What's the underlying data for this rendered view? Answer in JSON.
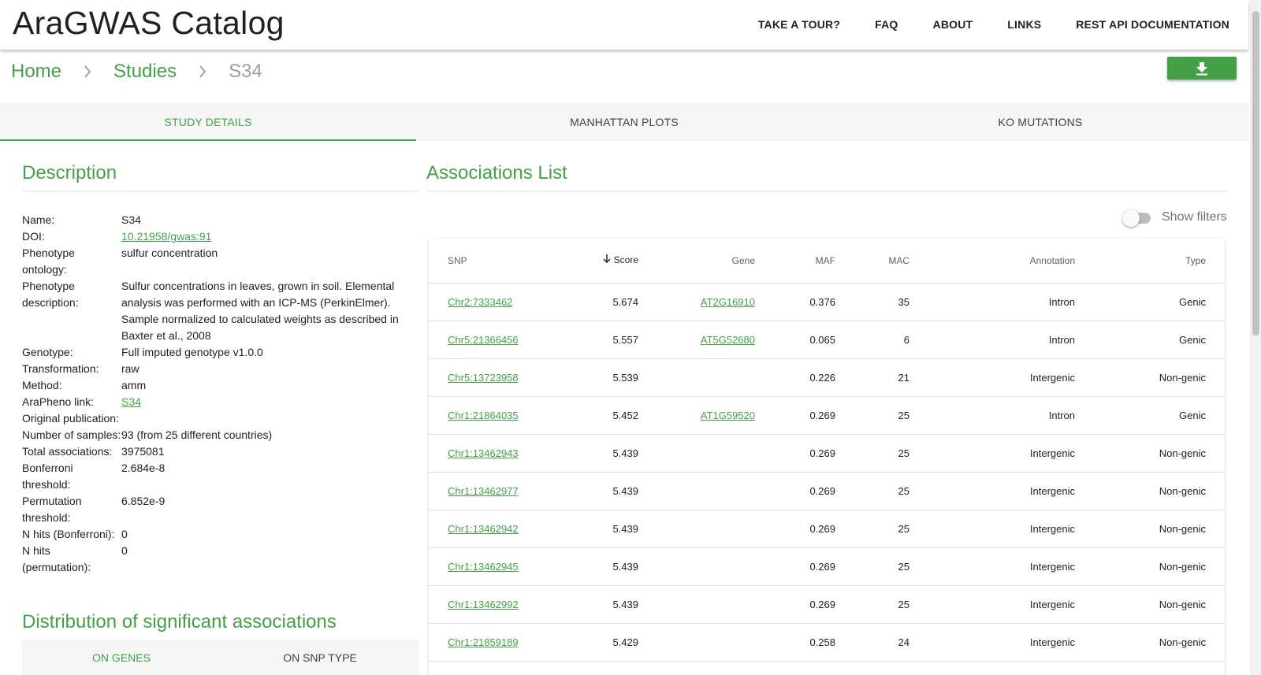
{
  "header": {
    "brand": "AraGWAS Catalog",
    "nav": [
      "TAKE A TOUR?",
      "FAQ",
      "ABOUT",
      "LINKS",
      "REST API DOCUMENTATION"
    ]
  },
  "breadcrumb": {
    "home": "Home",
    "studies": "Studies",
    "current": "S34"
  },
  "tabs": [
    "STUDY DETAILS",
    "MANHATTAN PLOTS",
    "KO MUTATIONS"
  ],
  "description": {
    "title": "Description",
    "fields": [
      {
        "label": "Name:",
        "value": "S34",
        "link": false
      },
      {
        "label": "DOI:",
        "value": "10.21958/gwas:91",
        "link": true
      },
      {
        "label": "Phenotype ontology:",
        "value": "sulfur concentration",
        "link": false
      },
      {
        "label": "Phenotype description:",
        "value": "Sulfur concentrations in leaves, grown in soil. Elemental analysis was performed with an ICP-MS (PerkinElmer). Sample normalized to calculated weights as described in Baxter et al., 2008",
        "link": false
      },
      {
        "label": "Genotype:",
        "value": "Full imputed genotype v1.0.0",
        "link": false
      },
      {
        "label": "Transformation:",
        "value": "raw",
        "link": false
      },
      {
        "label": "Method:",
        "value": "amm",
        "link": false
      },
      {
        "label": "AraPheno link:",
        "value": "S34",
        "link": true
      },
      {
        "label": "Original publication:",
        "value": "",
        "link": false
      },
      {
        "label": "Number of samples:",
        "value": "93 (from 25 different countries)",
        "link": false
      },
      {
        "label": "Total associations:",
        "value": "3975081",
        "link": false
      },
      {
        "label": "Bonferroni threshold:",
        "value": "2.684e-8",
        "link": false
      },
      {
        "label": "Permutation threshold:",
        "value": "6.852e-9",
        "link": false
      },
      {
        "label": "N hits (Bonferroni):",
        "value": "0",
        "link": false
      },
      {
        "label": "N hits (permutation):",
        "value": "0",
        "link": false
      }
    ]
  },
  "distribution": {
    "title": "Distribution of significant associations",
    "tabs": [
      "ON GENES",
      "ON SNP TYPE"
    ]
  },
  "associations": {
    "title": "Associations List",
    "filters_label": "Show filters",
    "columns": [
      "SNP",
      "Score",
      "Gene",
      "MAF",
      "MAC",
      "Annotation",
      "Type"
    ],
    "rows": [
      {
        "snp": "Chr2:7333462",
        "score": "5.674",
        "gene": "AT2G16910",
        "maf": "0.376",
        "mac": "35",
        "annotation": "Intron",
        "type": "Genic"
      },
      {
        "snp": "Chr5:21366456",
        "score": "5.557",
        "gene": "AT5G52680",
        "maf": "0.065",
        "mac": "6",
        "annotation": "Intron",
        "type": "Genic"
      },
      {
        "snp": "Chr5:13723958",
        "score": "5.539",
        "gene": "",
        "maf": "0.226",
        "mac": "21",
        "annotation": "Intergenic",
        "type": "Non-genic"
      },
      {
        "snp": "Chr1:21864035",
        "score": "5.452",
        "gene": "AT1G59520",
        "maf": "0.269",
        "mac": "25",
        "annotation": "Intron",
        "type": "Genic"
      },
      {
        "snp": "Chr1:13462943",
        "score": "5.439",
        "gene": "",
        "maf": "0.269",
        "mac": "25",
        "annotation": "Intergenic",
        "type": "Non-genic"
      },
      {
        "snp": "Chr1:13462977",
        "score": "5.439",
        "gene": "",
        "maf": "0.269",
        "mac": "25",
        "annotation": "Intergenic",
        "type": "Non-genic"
      },
      {
        "snp": "Chr1:13462942",
        "score": "5.439",
        "gene": "",
        "maf": "0.269",
        "mac": "25",
        "annotation": "Intergenic",
        "type": "Non-genic"
      },
      {
        "snp": "Chr1:13462945",
        "score": "5.439",
        "gene": "",
        "maf": "0.269",
        "mac": "25",
        "annotation": "Intergenic",
        "type": "Non-genic"
      },
      {
        "snp": "Chr1:13462992",
        "score": "5.439",
        "gene": "",
        "maf": "0.269",
        "mac": "25",
        "annotation": "Intergenic",
        "type": "Non-genic"
      },
      {
        "snp": "Chr1:21859189",
        "score": "5.429",
        "gene": "",
        "maf": "0.258",
        "mac": "24",
        "annotation": "Intergenic",
        "type": "Non-genic"
      }
    ]
  },
  "colors": {
    "accent": "#43a047",
    "muted": "#9e9e9e",
    "tab_bg": "#f5f5f5"
  },
  "icons": {
    "download": "download-icon",
    "separator": "chevron-right-icon",
    "sort": "arrow-down-icon"
  }
}
